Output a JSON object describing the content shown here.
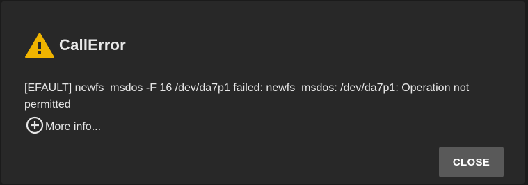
{
  "dialog": {
    "title": "CallError",
    "title_icon": "warning-triangle-icon",
    "message": "[EFAULT] newfs_msdos -F 16 /dev/da7p1 failed: newfs_msdos: /dev/da7p1: Operation not permitted",
    "more_info_label": "More info...",
    "more_info_icon": "add-circle-icon",
    "close_label": "CLOSE"
  },
  "colors": {
    "background": "#282828",
    "warning": "#f0b400",
    "text": "#e6e6e6",
    "button": "#595959"
  }
}
